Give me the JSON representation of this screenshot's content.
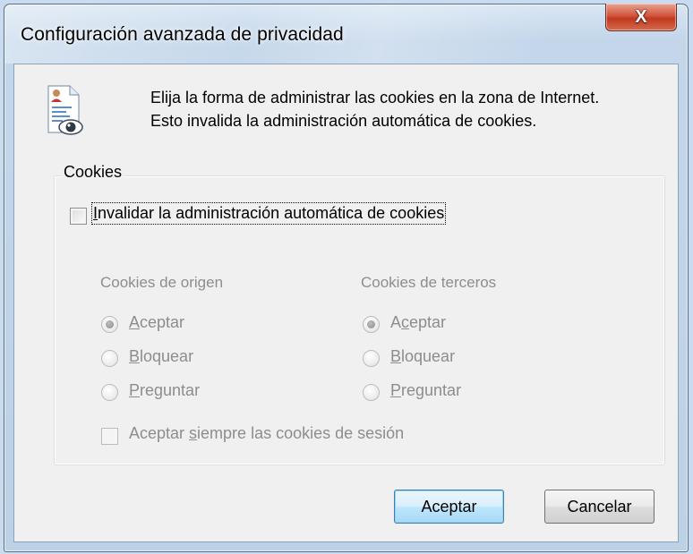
{
  "window": {
    "title": "Configuración avanzada de privacidad",
    "close_glyph": "X"
  },
  "intro": {
    "line1": "Elija la forma de administrar las cookies en la zona de Internet.",
    "line2": "Esto invalida la administración automática de cookies."
  },
  "group": {
    "legend": "Cookies",
    "override": {
      "mnemonic": "I",
      "rest": "nvalidar la administración automática de cookies",
      "checked": false
    },
    "first_party": {
      "header": "Cookies de origen",
      "selected": "Aceptar",
      "options": [
        {
          "pre": "",
          "mnemonic": "A",
          "post": "ceptar"
        },
        {
          "pre": "",
          "mnemonic": "B",
          "post": "loquear"
        },
        {
          "pre": "",
          "mnemonic": "P",
          "post": "reguntar"
        }
      ]
    },
    "third_party": {
      "header": "Cookies de terceros",
      "selected": "Aceptar",
      "options": [
        {
          "pre": "A",
          "mnemonic": "c",
          "post": "eptar"
        },
        {
          "pre": "",
          "mnemonic": "B",
          "post": "loquear"
        },
        {
          "pre": "",
          "mnemonic": "P",
          "post": "reguntar"
        }
      ]
    },
    "session": {
      "pre": "Aceptar ",
      "mnemonic": "s",
      "post": "iempre las cookies de sesión",
      "checked": false
    }
  },
  "buttons": {
    "ok": "Aceptar",
    "cancel": "Cancelar"
  },
  "icons": {
    "page": "privacy-document-eye-icon",
    "close": "close-icon"
  },
  "colors": {
    "disabled_text": "#8d8d8d",
    "close_button": "#c1391f",
    "default_button_border": "#3c7fb1"
  }
}
